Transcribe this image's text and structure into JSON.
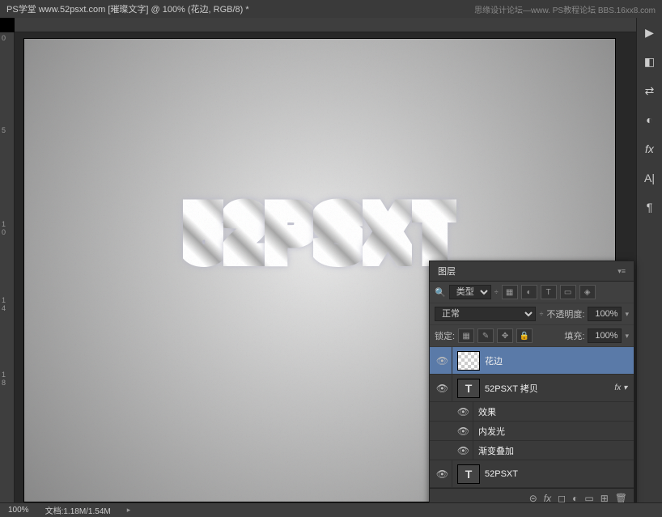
{
  "title_bar": {
    "left": "PS学堂  www.52psxt.com [璀璨文字] @ 100% (花边, RGB/8) *",
    "right": "思缘设计论坛—www. PS教程论坛  BBS.16xx8.com"
  },
  "canvas_text": "52PSXT",
  "right_tools": [
    "play",
    "color-picker",
    "swap",
    "adjust",
    "fx",
    "text",
    "paragraph"
  ],
  "layers_panel": {
    "title": "图层",
    "search_icon": "🔍",
    "type_label": "类型",
    "filter_icons": [
      "▦",
      "◐",
      "T",
      "▭",
      "◈"
    ],
    "blend_mode": "正常",
    "opacity_label": "不透明度:",
    "opacity_value": "100%",
    "lock_label": "锁定:",
    "fill_label": "填充:",
    "fill_value": "100%",
    "layers": [
      {
        "visible": true,
        "thumb": "checker",
        "name": "花边",
        "selected": true
      },
      {
        "visible": true,
        "thumb": "T",
        "name": "52PSXT 拷贝",
        "fx": true
      },
      {
        "visible": true,
        "sub": true,
        "name": "效果"
      },
      {
        "visible": true,
        "sub": true,
        "name": "内发光"
      },
      {
        "visible": true,
        "sub": true,
        "name": "渐变叠加"
      },
      {
        "visible": true,
        "thumb": "T",
        "name": "52PSXT"
      }
    ],
    "footer_icons": [
      "⊕",
      "fx",
      "⊡",
      "◐",
      "▭",
      "🗑"
    ]
  },
  "status_bar": {
    "zoom": "100%",
    "doc_info": "文档:1.18M/1.54M"
  },
  "ruler_v_marks": [
    "0",
    "",
    "",
    "",
    "5",
    "",
    "",
    "",
    "1",
    "0",
    "",
    "",
    "",
    "1",
    "4",
    "",
    "",
    "",
    "1",
    "8"
  ]
}
